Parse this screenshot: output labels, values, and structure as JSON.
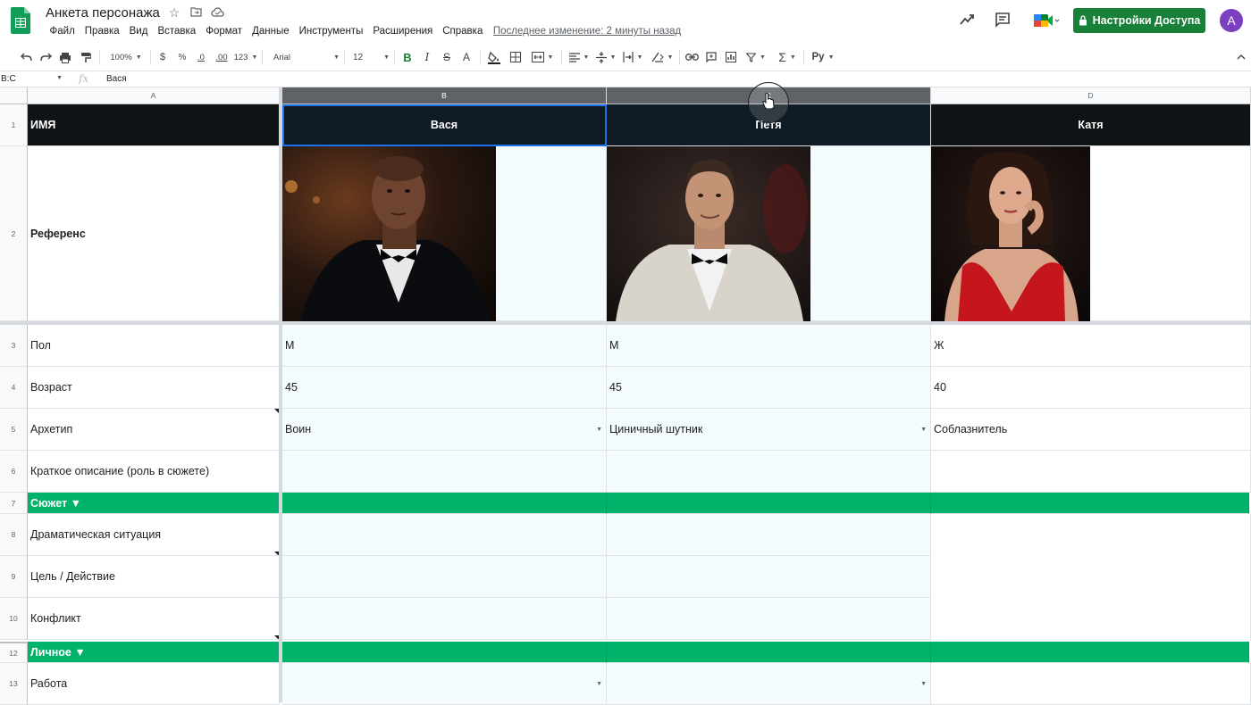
{
  "app": {
    "title": "Анкета персонажа",
    "menu": [
      "Файл",
      "Правка",
      "Вид",
      "Вставка",
      "Формат",
      "Данные",
      "Инструменты",
      "Расширения",
      "Справка"
    ],
    "last_edit": "Последнее изменение: 2 минуты назад",
    "share_label": "Настройки Доступа",
    "avatar_letter": "A",
    "colors": {
      "brand_green": "#188038",
      "sheets_green": "#0f9d58",
      "avatar": "#7b3fbf",
      "section_green": "#00b36b"
    }
  },
  "toolbar": {
    "zoom": "100%",
    "currency": "$",
    "percent": "%",
    "dec_less": ".0",
    "dec_more": ".00",
    "number_format": "123",
    "font": "Arial",
    "font_size": "12",
    "bold": "B",
    "italic": "I",
    "strike": "S",
    "text_color": "A",
    "sum": "Σ",
    "input_tools": "Py",
    "icons": [
      "undo-icon",
      "redo-icon",
      "print-icon",
      "paint-format-icon",
      "fill-color-icon",
      "borders-icon",
      "merge-icon",
      "align-h-icon",
      "align-v-icon",
      "wrap-icon",
      "rotate-icon",
      "link-icon",
      "comment-icon",
      "chart-icon",
      "filter-icon",
      "functions-icon",
      "input-tools-icon",
      "collapse-icon"
    ]
  },
  "formula": {
    "name_box": "B:C",
    "fx": "fx",
    "value": "Вася"
  },
  "columns": [
    "A",
    "B",
    "C",
    "D"
  ],
  "rows": [
    {
      "num": "1",
      "label": "ИМЯ",
      "b": "Вася",
      "c": "Петя",
      "d": "Катя"
    },
    {
      "num": "2",
      "label": "Референс"
    },
    {
      "num": "3",
      "label": "Пол",
      "b": "М",
      "c": "М",
      "d": "Ж"
    },
    {
      "num": "4",
      "label": "Возраст",
      "b": "45",
      "c": "45",
      "d": "40"
    },
    {
      "num": "5",
      "label": "Архетип",
      "b": "Воин",
      "c": "Циничный шутник",
      "d": "Соблазнитель"
    },
    {
      "num": "6",
      "label": "Краткое описание (роль в сюжете)"
    },
    {
      "num": "7",
      "label": "Сюжет ▼"
    },
    {
      "num": "8",
      "label": "Драматическая ситуация"
    },
    {
      "num": "9",
      "label": "Цель / Действие"
    },
    {
      "num": "10",
      "label": "Конфликт"
    },
    {
      "num": "12",
      "label": "Личное ▼"
    },
    {
      "num": "13",
      "label": "Работа"
    }
  ]
}
